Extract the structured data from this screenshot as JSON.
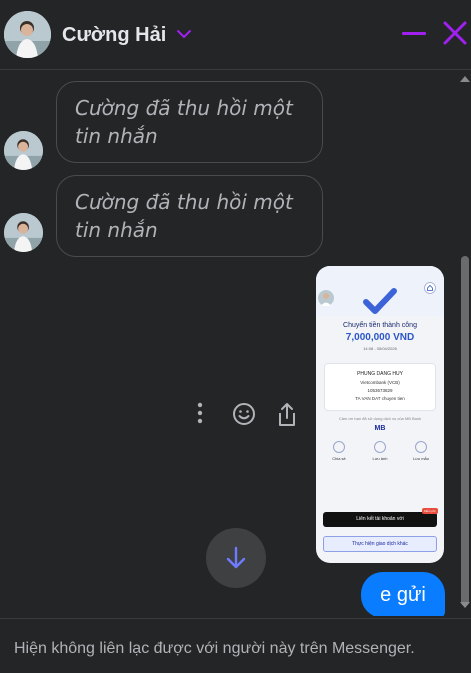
{
  "header": {
    "contact_name": "Cường Hải"
  },
  "messages": {
    "recalled_1": "Cường đã thu hồi một tin nhắn",
    "recalled_2": "Cường đã thu hồi một tin nhắn",
    "sent_text": "e gửi"
  },
  "image_attachment": {
    "title": "Chuyển tiền thành công",
    "amount": "7,000,000 VND",
    "date": "14:08 - 05/04/2026",
    "recipient_name": "PHUNG DANG HUY",
    "bank": "Vietcombank (VCB)",
    "account": "1053673829",
    "description": "TA VAN DAT chuyen tien",
    "note": "Cảm ơn bạn đã sử dụng dịch vụ của MB Bank",
    "bank_logo": "MB",
    "icon_labels": [
      "Chia sẻ",
      "Lưu ảnh",
      "Lưu mẫu"
    ],
    "primary_button": "Liên kết tài khoản với",
    "badge": "Miễn phí",
    "secondary_button": "Thực hiện giao dịch khác"
  },
  "footer": {
    "notice": "Hiện không liên lạc được với người này trên Messenger."
  },
  "colors": {
    "background": "#242526",
    "accent": "#a020f0",
    "sent_bubble": "#0a7cff",
    "scroll_button_arrow": "#6e7bff"
  }
}
